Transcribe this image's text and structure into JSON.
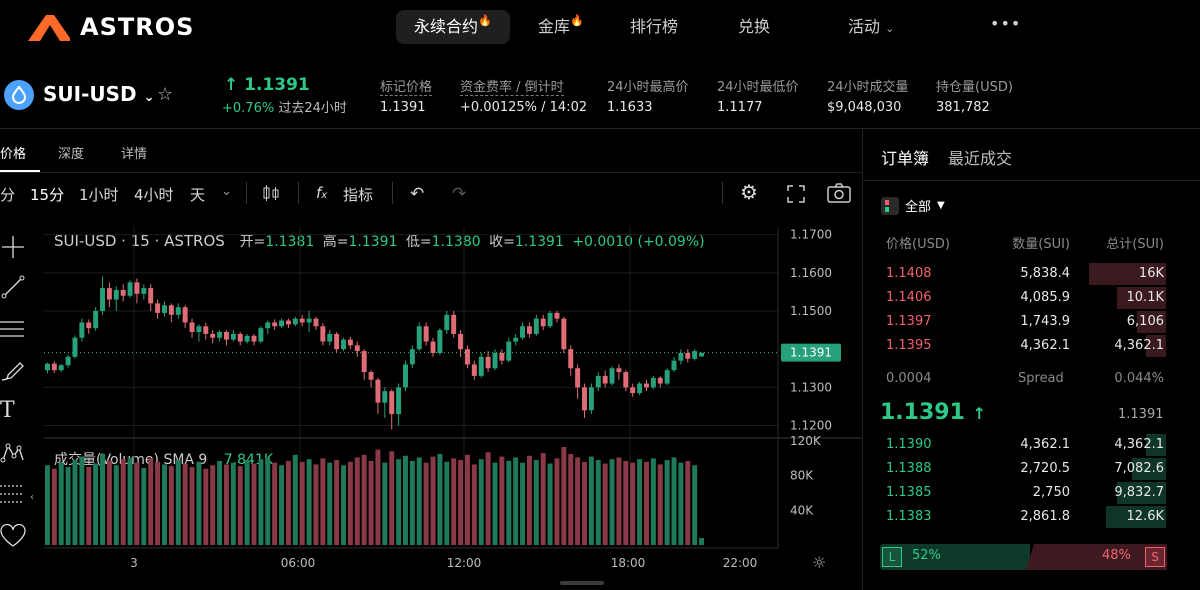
{
  "nav": {
    "brand": "ASTROS",
    "items": [
      {
        "label": "永续合约",
        "active": true,
        "hot": true
      },
      {
        "label": "金库",
        "active": false,
        "hot": true
      },
      {
        "label": "排行榜",
        "active": false,
        "hot": false
      },
      {
        "label": "兑换",
        "active": false,
        "hot": false
      },
      {
        "label": "活动",
        "active": false,
        "hot": false
      }
    ],
    "more": "•••"
  },
  "ticker": {
    "pair": "SUI-USD",
    "price": "↑ 1.1391",
    "change": "+0.76%",
    "change_period": "过去24小时",
    "stats": [
      {
        "label": "标记价格",
        "value": "1.1391"
      },
      {
        "label": "资金费率 / 倒计时",
        "value": "+0.00125% /  14:02"
      },
      {
        "label": "24小时最高价",
        "value": "1.1633"
      },
      {
        "label": "24小时最低价",
        "value": "1.1177"
      },
      {
        "label": "24小时成交量",
        "value": "$9,048,030"
      },
      {
        "label": "持仓量(USD)",
        "value": "381,782"
      }
    ]
  },
  "chart_tabs": [
    "价格",
    "深度",
    "详情"
  ],
  "toolbar": {
    "intervals": [
      "分",
      "15分",
      "1小时",
      "4小时",
      "天"
    ],
    "indicators": "指标"
  },
  "chart": {
    "legend_title": "SUI-USD · 15 · ASTROS",
    "open_label": "开=",
    "open": "1.1381",
    "high_label": "高=",
    "high": "1.1391",
    "low_label": "低=",
    "low": "1.1380",
    "close_label": "收=",
    "close": "1.1391",
    "change": "+0.0010 (+0.09%)",
    "volume_label": "成交量(Volume) SMA 9",
    "volume_value": "7.841K",
    "price_ticks": [
      "1.1700",
      "1.1600",
      "1.1500",
      "1.1391",
      "1.1300",
      "1.1200"
    ],
    "volume_ticks": [
      "120K",
      "80K",
      "40K"
    ],
    "time_ticks": [
      "3",
      "06:00",
      "12:00",
      "18:00",
      "22:00"
    ],
    "last_price": "1.1391",
    "colors": {
      "up": "#26a17b",
      "down": "#e06c78",
      "bg": "#000000"
    }
  },
  "chart_data": {
    "type": "candlestick",
    "x": "15-minute candles",
    "price_range": [
      1.117,
      1.172
    ],
    "candles": [
      [
        1.1345,
        1.1362,
        1.1337,
        1.1365
      ],
      [
        1.1362,
        1.1345,
        1.1338,
        1.1368
      ],
      [
        1.1345,
        1.1358,
        1.134,
        1.1362
      ],
      [
        1.1358,
        1.138,
        1.1352,
        1.1385
      ],
      [
        1.138,
        1.143,
        1.1375,
        1.1436
      ],
      [
        1.143,
        1.147,
        1.142,
        1.148
      ],
      [
        1.147,
        1.1455,
        1.144,
        1.1478
      ],
      [
        1.1455,
        1.15,
        1.1448,
        1.151
      ],
      [
        1.15,
        1.156,
        1.149,
        1.159
      ],
      [
        1.156,
        1.153,
        1.151,
        1.1575
      ],
      [
        1.153,
        1.1555,
        1.15,
        1.1565
      ],
      [
        1.1555,
        1.154,
        1.1525,
        1.157
      ],
      [
        1.154,
        1.1575,
        1.1535,
        1.158
      ],
      [
        1.1575,
        1.1545,
        1.152,
        1.1585
      ],
      [
        1.1545,
        1.156,
        1.153,
        1.157
      ],
      [
        1.156,
        1.152,
        1.15,
        1.157
      ],
      [
        1.152,
        1.1495,
        1.148,
        1.153
      ],
      [
        1.1495,
        1.1515,
        1.1485,
        1.1525
      ],
      [
        1.1515,
        1.149,
        1.147,
        1.152
      ],
      [
        1.149,
        1.151,
        1.148,
        1.152
      ],
      [
        1.151,
        1.147,
        1.1455,
        1.1515
      ],
      [
        1.147,
        1.1445,
        1.143,
        1.148
      ],
      [
        1.1445,
        1.146,
        1.142,
        1.1465
      ],
      [
        1.146,
        1.144,
        1.1425,
        1.147
      ],
      [
        1.144,
        1.143,
        1.1415,
        1.145
      ],
      [
        1.143,
        1.1445,
        1.142,
        1.145
      ],
      [
        1.1445,
        1.1425,
        1.141,
        1.145
      ],
      [
        1.1425,
        1.144,
        1.142,
        1.145
      ],
      [
        1.144,
        1.142,
        1.141,
        1.1445
      ],
      [
        1.142,
        1.1435,
        1.1415,
        1.144
      ],
      [
        1.1435,
        1.142,
        1.141,
        1.144
      ],
      [
        1.142,
        1.1455,
        1.1415,
        1.146
      ],
      [
        1.1455,
        1.147,
        1.144,
        1.1475
      ],
      [
        1.147,
        1.146,
        1.145,
        1.1478
      ],
      [
        1.146,
        1.1475,
        1.1455,
        1.148
      ],
      [
        1.1475,
        1.1465,
        1.1455,
        1.148
      ],
      [
        1.1465,
        1.148,
        1.146,
        1.1485
      ],
      [
        1.148,
        1.147,
        1.146,
        1.149
      ],
      [
        1.147,
        1.148,
        1.1445,
        1.15
      ],
      [
        1.148,
        1.146,
        1.145,
        1.1485
      ],
      [
        1.146,
        1.142,
        1.141,
        1.1468
      ],
      [
        1.142,
        1.144,
        1.141,
        1.145
      ],
      [
        1.144,
        1.14,
        1.139,
        1.1445
      ],
      [
        1.14,
        1.1425,
        1.1395,
        1.143
      ],
      [
        1.1425,
        1.141,
        1.14,
        1.1432
      ],
      [
        1.141,
        1.1395,
        1.138,
        1.142
      ],
      [
        1.1395,
        1.134,
        1.132,
        1.14
      ],
      [
        1.134,
        1.132,
        1.13,
        1.1345
      ],
      [
        1.132,
        1.126,
        1.123,
        1.1325
      ],
      [
        1.126,
        1.129,
        1.122,
        1.13
      ],
      [
        1.129,
        1.123,
        1.119,
        1.1295
      ],
      [
        1.123,
        1.13,
        1.12,
        1.131
      ],
      [
        1.13,
        1.136,
        1.129,
        1.137
      ],
      [
        1.136,
        1.14,
        1.135,
        1.141
      ],
      [
        1.14,
        1.146,
        1.1395,
        1.147
      ],
      [
        1.146,
        1.142,
        1.141,
        1.147
      ],
      [
        1.142,
        1.139,
        1.138,
        1.143
      ],
      [
        1.139,
        1.145,
        1.1385,
        1.1455
      ],
      [
        1.145,
        1.149,
        1.144,
        1.15
      ],
      [
        1.149,
        1.144,
        1.143,
        1.15
      ],
      [
        1.144,
        1.14,
        1.138,
        1.145
      ],
      [
        1.14,
        1.136,
        1.135,
        1.141
      ],
      [
        1.136,
        1.133,
        1.132,
        1.137
      ],
      [
        1.133,
        1.138,
        1.1325,
        1.139
      ],
      [
        1.138,
        1.135,
        1.134,
        1.1395
      ],
      [
        1.135,
        1.139,
        1.1345,
        1.14
      ],
      [
        1.139,
        1.137,
        1.136,
        1.14
      ],
      [
        1.137,
        1.142,
        1.1365,
        1.143
      ],
      [
        1.142,
        1.143,
        1.141,
        1.144
      ],
      [
        1.143,
        1.146,
        1.1425,
        1.147
      ],
      [
        1.146,
        1.144,
        1.143,
        1.147
      ],
      [
        1.144,
        1.148,
        1.1435,
        1.149
      ],
      [
        1.148,
        1.146,
        1.145,
        1.149
      ],
      [
        1.146,
        1.1495,
        1.1455,
        1.15
      ],
      [
        1.1495,
        1.148,
        1.147,
        1.15
      ],
      [
        1.148,
        1.14,
        1.139,
        1.1485
      ],
      [
        1.14,
        1.135,
        1.133,
        1.141
      ],
      [
        1.135,
        1.13,
        1.127,
        1.136
      ],
      [
        1.13,
        1.124,
        1.122,
        1.131
      ],
      [
        1.124,
        1.13,
        1.123,
        1.131
      ],
      [
        1.13,
        1.133,
        1.129,
        1.134
      ],
      [
        1.133,
        1.131,
        1.13,
        1.1345
      ],
      [
        1.131,
        1.135,
        1.1305,
        1.1355
      ],
      [
        1.135,
        1.134,
        1.132,
        1.136
      ],
      [
        1.134,
        1.13,
        1.129,
        1.1345
      ],
      [
        1.13,
        1.1285,
        1.1275,
        1.131
      ],
      [
        1.1285,
        1.131,
        1.128,
        1.1315
      ],
      [
        1.131,
        1.13,
        1.129,
        1.132
      ],
      [
        1.13,
        1.1325,
        1.1295,
        1.133
      ],
      [
        1.1325,
        1.131,
        1.13,
        1.133
      ],
      [
        1.131,
        1.1345,
        1.1305,
        1.135
      ],
      [
        1.1345,
        1.137,
        1.134,
        1.138
      ],
      [
        1.137,
        1.139,
        1.136,
        1.14
      ],
      [
        1.139,
        1.1375,
        1.1365,
        1.14
      ],
      [
        1.1375,
        1.1395,
        1.137,
        1.14
      ],
      [
        1.1381,
        1.1391,
        1.138,
        1.1391
      ]
    ],
    "volume_range": [
      0,
      120
    ],
    "volume_k": [
      92,
      88,
      95,
      90,
      98,
      102,
      90,
      94,
      105,
      97,
      92,
      99,
      101,
      95,
      89,
      100,
      96,
      93,
      91,
      98,
      94,
      90,
      96,
      88,
      92,
      97,
      93,
      95,
      91,
      98,
      94,
      99,
      101,
      95,
      92,
      97,
      104,
      96,
      99,
      93,
      100,
      95,
      98,
      92,
      96,
      101,
      104,
      97,
      110,
      95,
      108,
      99,
      103,
      97,
      101,
      95,
      102,
      105,
      96,
      100,
      98,
      104,
      93,
      99,
      107,
      95,
      102,
      97,
      101,
      95,
      103,
      98,
      106,
      94,
      100,
      113,
      105,
      101,
      96,
      102,
      98,
      94,
      99,
      101,
      97,
      95,
      99,
      96,
      100,
      93,
      98,
      101,
      95,
      97,
      92,
      8
    ],
    "last_price": 1.1391
  },
  "orderbook": {
    "tabs": [
      "订单簿",
      "最近成交"
    ],
    "filter": "全部",
    "headers": [
      "价格(USD)",
      "数量(SUI)",
      "总计(SUI)"
    ],
    "asks": [
      {
        "price": "1.1408",
        "size": "5,838.4",
        "total": "16K",
        "depth": 0.27
      },
      {
        "price": "1.1406",
        "size": "4,085.9",
        "total": "10.1K",
        "depth": 0.17
      },
      {
        "price": "1.1397",
        "size": "1,743.9",
        "total": "6,106",
        "depth": 0.1
      },
      {
        "price": "1.1395",
        "size": "4,362.1",
        "total": "4,362.1",
        "depth": 0.07
      }
    ],
    "spread_value": "0.0004",
    "spread_label": "Spread",
    "spread_pct": "0.044%",
    "mid_price": "1.1391",
    "mid_arrow": "↑",
    "mark_price": "1.1391",
    "bids": [
      {
        "price": "1.1390",
        "size": "4,362.1",
        "total": "4,362.1",
        "depth": 0.07
      },
      {
        "price": "1.1388",
        "size": "2,720.5",
        "total": "7,082.6",
        "depth": 0.12
      },
      {
        "price": "1.1385",
        "size": "2,750",
        "total": "9,832.7",
        "depth": 0.17
      },
      {
        "price": "1.1383",
        "size": "2,861.8",
        "total": "12.6K",
        "depth": 0.21
      }
    ],
    "long_label": "L",
    "long_pct": "52%",
    "short_pct": "48%",
    "short_label": "S"
  }
}
